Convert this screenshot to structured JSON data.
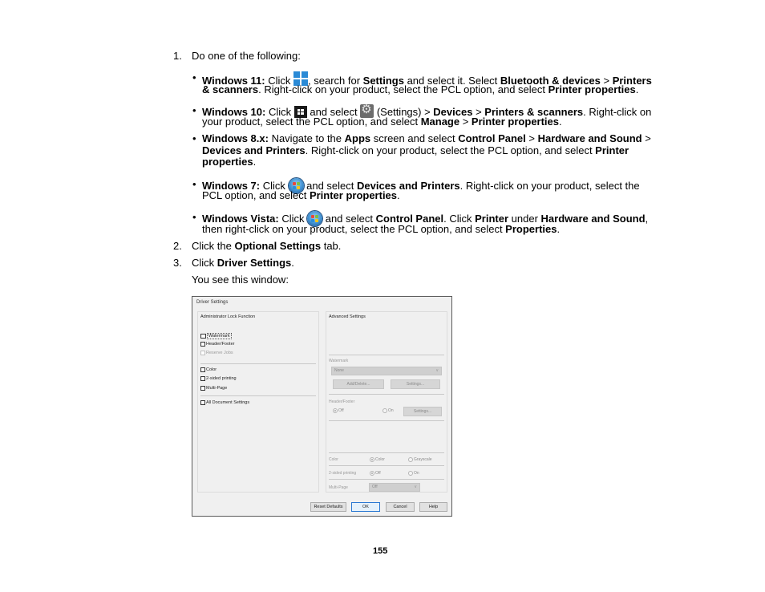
{
  "steps": [
    {
      "number": "1.",
      "text": "Do one of the following:"
    },
    {
      "number": "2.",
      "parts": [
        "Click the ",
        "Optional Settings",
        " tab."
      ]
    },
    {
      "number": "3.",
      "parts": [
        "Click ",
        "Driver Settings",
        "."
      ]
    }
  ],
  "after_steps_text": "You see this window:",
  "bullets": {
    "win11": {
      "label": "Windows 11:",
      "icon": "windows-11-start-icon",
      "l1": [
        " Click ",
        ", search for ",
        "Settings",
        " and select it. Select ",
        "Bluetooth & devices",
        " > ",
        "Printers"
      ],
      "l2": [
        "& scanners",
        ". Right-click on your product, select the PCL option, and select ",
        "Printer properties",
        "."
      ]
    },
    "win10": {
      "label": "Windows 10:",
      "icon": "windows-10-start-icon",
      "icon2": "settings-gear-icon",
      "l1": [
        " Click ",
        " and select ",
        " (Settings) > ",
        "Devices",
        " > ",
        "Printers & scanners",
        ". Right-click on"
      ],
      "l2": [
        "your product, select the PCL option, and select ",
        "Manage",
        " > ",
        "Printer properties",
        "."
      ]
    },
    "win8": {
      "label": "Windows 8.x:",
      "l1": [
        " Navigate to the ",
        "Apps",
        " screen and select ",
        "Control Panel",
        " > ",
        "Hardware and Sound",
        " >"
      ],
      "l2": [
        "Devices and Printers",
        ". Right-click on your product, select the PCL option, and select ",
        "Printer"
      ],
      "l3": [
        "properties",
        "."
      ]
    },
    "win7": {
      "label": "Windows 7:",
      "icon": "windows-7-start-orb-icon",
      "l1": [
        " Click ",
        " and select ",
        "Devices and Printers",
        ". Right-click on your product, select the"
      ],
      "l2": [
        "PCL option, and select ",
        "Printer properties",
        "."
      ]
    },
    "vista": {
      "label": "Windows Vista:",
      "icon": "windows-vista-start-orb-icon",
      "l1": [
        " Click ",
        " and select ",
        "Control Panel",
        ". Click ",
        "Printer",
        " under ",
        "Hardware and Sound",
        ","
      ],
      "l2": [
        "then right-click on your product, select the PCL option, and select ",
        "Properties",
        "."
      ]
    }
  },
  "dialog": {
    "title": "Driver Settings",
    "left_group": {
      "title": "Administrator Lock Function",
      "checkboxes": [
        {
          "label": "Watermark",
          "checked": false,
          "enabled": true
        },
        {
          "label": "Header/Footer",
          "checked": false,
          "enabled": true
        },
        {
          "label": "Reserve Jobs",
          "checked": false,
          "enabled": false
        },
        {
          "label": "Color",
          "checked": false,
          "enabled": true
        },
        {
          "label": "2-sided printing",
          "checked": false,
          "enabled": true
        },
        {
          "label": "Multi-Page",
          "checked": false,
          "enabled": true
        },
        {
          "label": "All Document Settings",
          "checked": false,
          "enabled": true
        }
      ]
    },
    "right_group": {
      "title": "Advanced Settings",
      "watermark": {
        "label": "Watermark",
        "value": "None",
        "add_delete": "Add/Delete...",
        "settings": "Settings..."
      },
      "header_footer": {
        "label": "Header/Footer",
        "off": "Off",
        "on": "On",
        "selected": "Off",
        "settings": "Settings..."
      },
      "color": {
        "label": "Color",
        "opt1": "Color",
        "opt2": "Grayscale",
        "selected": "Color"
      },
      "two_sided": {
        "label": "2-sided printing",
        "opt1": "Off",
        "opt2": "On",
        "selected": "Off"
      },
      "multi_page": {
        "label": "Multi-Page",
        "value": "Off"
      }
    },
    "buttons": {
      "reset": "Reset Defaults",
      "ok": "OK",
      "cancel": "Cancel",
      "help": "Help"
    }
  },
  "page_number": "155"
}
